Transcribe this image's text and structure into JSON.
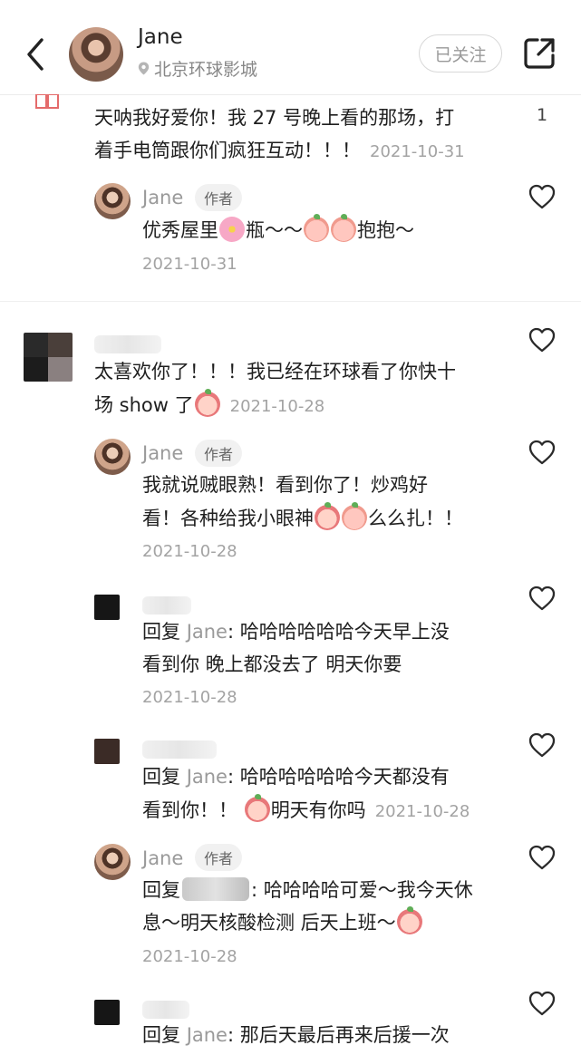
{
  "header": {
    "name": "Jane",
    "location": "北京环球影城",
    "follow_label": "已关注"
  },
  "top_number": "1",
  "comments": [
    {
      "text": "天呐我好爱你！我 27 号晚上看的那场，打",
      "text2": "着手电筒跟你们疯狂互动！！！",
      "date": "2021-10-31"
    },
    {
      "author": "Jane",
      "badge": "作者",
      "text_a": "优秀屋里",
      "text_b": "瓶～～",
      "text_c": "抱抱～",
      "date": "2021-10-31"
    },
    {
      "text": "太喜欢你了！！！我已经在环球看了你快十",
      "text2": "场 show 了",
      "date": "2021-10-28"
    },
    {
      "author": "Jane",
      "badge": "作者",
      "text": "我就说贼眼熟！看到你了！炒鸡好",
      "text2_a": "看！各种给我小眼神",
      "text2_b": "么么扎！！",
      "date": "2021-10-28"
    },
    {
      "reply_kw": "回复",
      "reply_to": "Jane",
      "text": ": 哈哈哈哈哈哈今天早上没",
      "text2": "看到你 晚上都没去了 明天你要",
      "date": "2021-10-28"
    },
    {
      "reply_kw": "回复",
      "reply_to": "Jane",
      "text": ": 哈哈哈哈哈哈今天都没有",
      "text2_a": "看到你！！",
      "text2_b": "明天有你吗",
      "date": "2021-10-28"
    },
    {
      "author": "Jane",
      "badge": "作者",
      "reply_kw": "回复",
      "text": ": 哈哈哈哈可爱～我今天休",
      "text2": "息～明天核酸检测 后天上班～",
      "date": "2021-10-28"
    },
    {
      "reply_kw": "回复",
      "reply_to": "Jane",
      "text": ": 那后天最后再来后援一次"
    }
  ]
}
